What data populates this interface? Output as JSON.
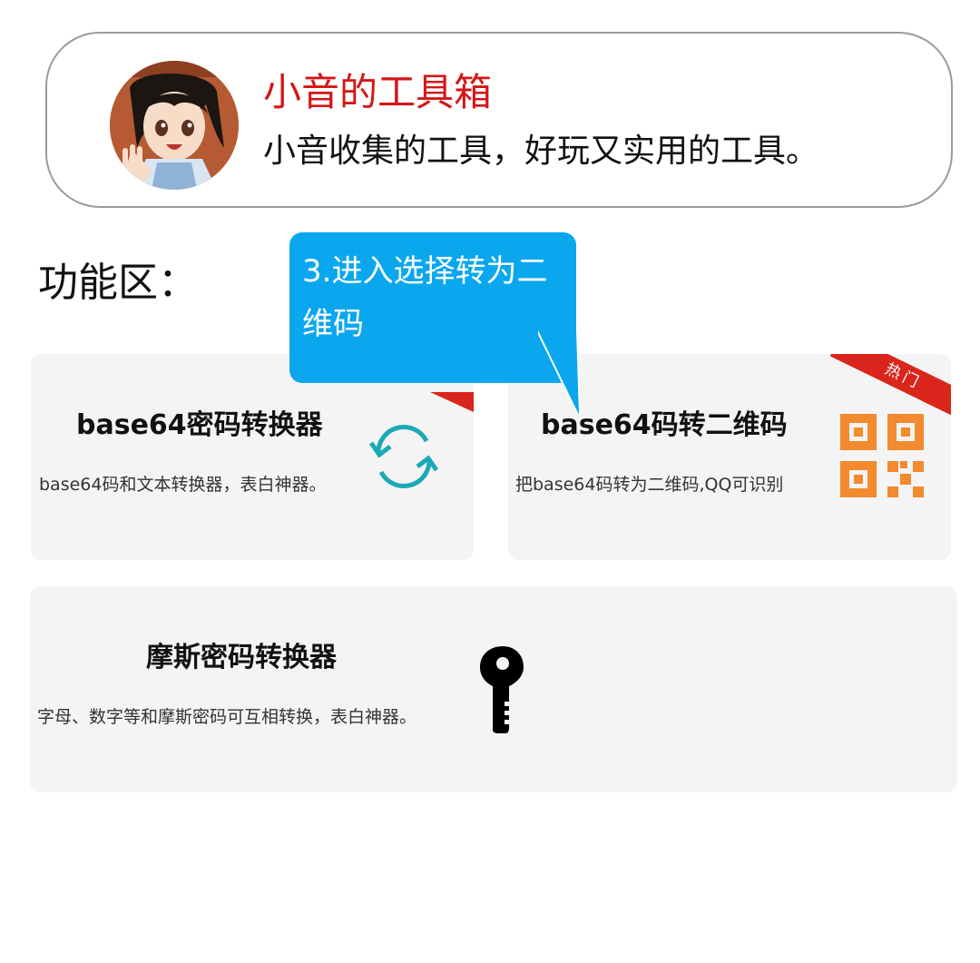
{
  "header": {
    "title": "小音的工具箱",
    "subtitle": "小音收集的工具，好玩又实用的工具。"
  },
  "section": {
    "title": "功能区："
  },
  "tooltip": {
    "text": "3.进入选择转为二维码"
  },
  "cards": [
    {
      "title": "base64密码转换器",
      "description": "base64码和文本转换器，表白神器。",
      "icon": "refresh-icon",
      "hot": false
    },
    {
      "title": "base64码转二维码",
      "description": "把base64码转为二维码,QQ可识别",
      "icon": "qr-code-icon",
      "hot": true,
      "hot_label": "热门"
    },
    {
      "title": "摩斯密码转换器",
      "description": "字母、数字等和摩斯密码可互相转换，表白神器。",
      "icon": "key-icon",
      "hot": false
    }
  ],
  "colors": {
    "title_red": "#d41616",
    "tooltip_blue": "#0aa7ef",
    "hot_red": "#d9251c",
    "qr_orange": "#f28a2e",
    "refresh_teal": "#1aa9b7",
    "card_bg": "#f4f4f4"
  }
}
